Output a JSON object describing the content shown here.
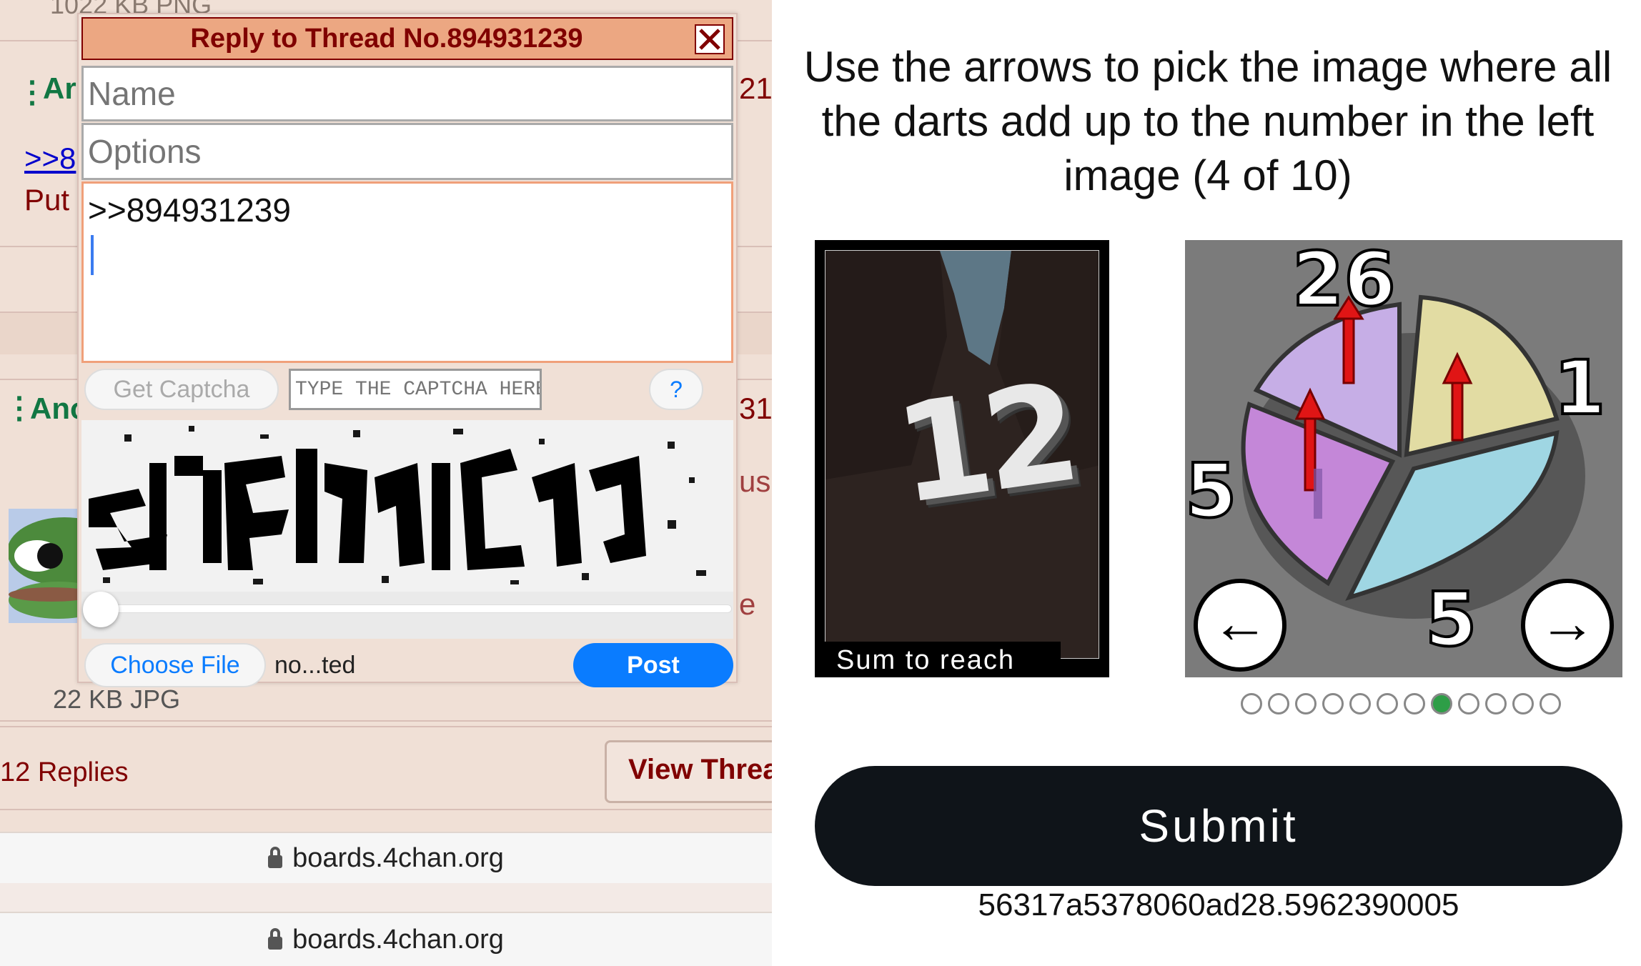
{
  "left_panel": {
    "background_texts": {
      "top_filesize": "1022 KB PNG",
      "post1_name_fragment": "Ar",
      "post1_num_fragment": "21",
      "quote_fragment": ">>8",
      "post_text_fragment": "Put",
      "post2_name_fragment": "Ano",
      "post2_num_fragment": "31",
      "side_fragment_us": "us",
      "side_fragment_e": "e",
      "bottom_filesize": "22 KB JPG",
      "replies_count": "12 Replies",
      "view_thread": "View Threa"
    },
    "quick_reply": {
      "title": "Reply to Thread No.894931239",
      "name_placeholder": "Name",
      "options_placeholder": "Options",
      "comment_value": ">>894931239",
      "get_captcha_label": "Get Captcha",
      "captcha_placeholder": "TYPE THE CAPTCHA HERE",
      "help_label": "?",
      "choose_file_label": "Choose File",
      "file_status": "no...ted",
      "post_label": "Post"
    },
    "url_bars": [
      "boards.4chan.org",
      "boards.4chan.org"
    ]
  },
  "right_panel": {
    "instruction": "Use the arrows to pick the image where all the darts add up to the number in the left image (4 of 10)",
    "target_image": {
      "number": "12",
      "caption": "Sum to reach"
    },
    "choice_image": {
      "segment_numbers": [
        "26",
        "1",
        "5",
        "5"
      ]
    },
    "prev_arrow": "←",
    "next_arrow": "→",
    "pagination": {
      "total": 12,
      "active_index": 7
    },
    "submit_label": "Submit",
    "session_id": "56317a5378060ad28.5962390005"
  },
  "colors": {
    "board_bg": "#f0e0d6",
    "maroon": "#800000",
    "accent_blue": "#0a7cff",
    "submit_bg": "#0f1419",
    "dot_active": "#2e9e47"
  }
}
